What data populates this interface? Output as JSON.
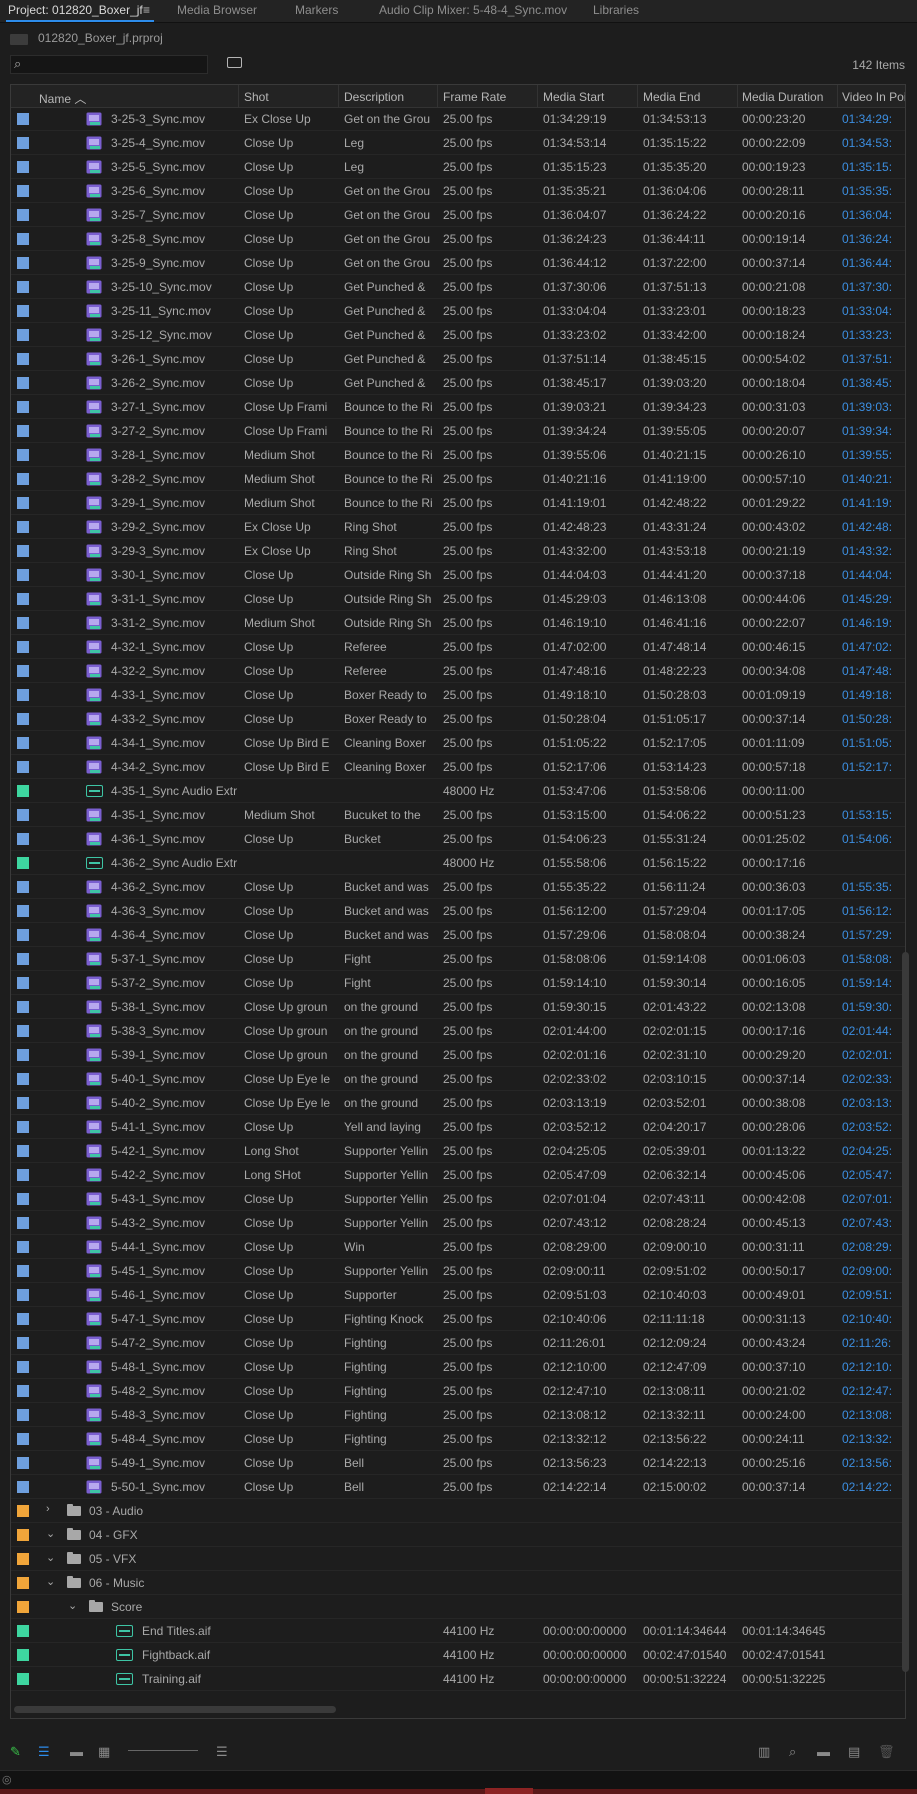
{
  "tabs": [
    {
      "label": "Project: 012820_Boxer_jf",
      "active": true
    },
    {
      "label": "Media Browser"
    },
    {
      "label": "Markers"
    },
    {
      "label": "Audio Clip Mixer: 5-48-4_Sync.mov"
    },
    {
      "label": "Libraries"
    }
  ],
  "tab_menu_icon": "≡",
  "project_path": "012820_Boxer_jf.prproj",
  "search": {
    "placeholder": "",
    "value": ""
  },
  "item_count": "142 Items",
  "columns": [
    "Name",
    "Shot",
    "Description",
    "Frame Rate",
    "Media Start",
    "Media End",
    "Media Duration",
    "Video In Poi"
  ],
  "colors": {
    "blue_label": "#6e9fde",
    "green_label": "#3ed6a0",
    "orange_label": "#f0a53a",
    "link_blue": "#3c8ee0",
    "tab_accent": "#2d8ceb"
  },
  "rows": [
    {
      "name": "3-25-3_Sync.mov",
      "shot": "Ex Close Up",
      "desc": "Get on the Grou",
      "rate": "25.00 fps",
      "start": "01:34:29:19",
      "end": "01:34:53:13",
      "dur": "00:00:23:20",
      "vin": "01:34:29:"
    },
    {
      "name": "3-25-4_Sync.mov",
      "shot": "Close Up",
      "desc": "Leg",
      "rate": "25.00 fps",
      "start": "01:34:53:14",
      "end": "01:35:15:22",
      "dur": "00:00:22:09",
      "vin": "01:34:53:"
    },
    {
      "name": "3-25-5_Sync.mov",
      "shot": "Close Up",
      "desc": "Leg",
      "rate": "25.00 fps",
      "start": "01:35:15:23",
      "end": "01:35:35:20",
      "dur": "00:00:19:23",
      "vin": "01:35:15:"
    },
    {
      "name": "3-25-6_Sync.mov",
      "shot": "Close Up",
      "desc": "Get on the Grou",
      "rate": "25.00 fps",
      "start": "01:35:35:21",
      "end": "01:36:04:06",
      "dur": "00:00:28:11",
      "vin": "01:35:35:"
    },
    {
      "name": "3-25-7_Sync.mov",
      "shot": "Close Up",
      "desc": "Get on the Grou",
      "rate": "25.00 fps",
      "start": "01:36:04:07",
      "end": "01:36:24:22",
      "dur": "00:00:20:16",
      "vin": "01:36:04:"
    },
    {
      "name": "3-25-8_Sync.mov",
      "shot": "Close Up",
      "desc": "Get on the Grou",
      "rate": "25.00 fps",
      "start": "01:36:24:23",
      "end": "01:36:44:11",
      "dur": "00:00:19:14",
      "vin": "01:36:24:"
    },
    {
      "name": "3-25-9_Sync.mov",
      "shot": "Close Up",
      "desc": "Get on the Grou",
      "rate": "25.00 fps",
      "start": "01:36:44:12",
      "end": "01:37:22:00",
      "dur": "00:00:37:14",
      "vin": "01:36:44:"
    },
    {
      "name": "3-25-10_Sync.mov",
      "shot": "Close Up",
      "desc": "Get Punched &",
      "rate": "25.00 fps",
      "start": "01:37:30:06",
      "end": "01:37:51:13",
      "dur": "00:00:21:08",
      "vin": "01:37:30:"
    },
    {
      "name": "3-25-11_Sync.mov",
      "shot": "Close Up",
      "desc": "Get Punched &",
      "rate": "25.00 fps",
      "start": "01:33:04:04",
      "end": "01:33:23:01",
      "dur": "00:00:18:23",
      "vin": "01:33:04:"
    },
    {
      "name": "3-25-12_Sync.mov",
      "shot": "Close Up",
      "desc": "Get Punched &",
      "rate": "25.00 fps",
      "start": "01:33:23:02",
      "end": "01:33:42:00",
      "dur": "00:00:18:24",
      "vin": "01:33:23:"
    },
    {
      "name": "3-26-1_Sync.mov",
      "shot": "Close Up",
      "desc": "Get Punched &",
      "rate": "25.00 fps",
      "start": "01:37:51:14",
      "end": "01:38:45:15",
      "dur": "00:00:54:02",
      "vin": "01:37:51:"
    },
    {
      "name": "3-26-2_Sync.mov",
      "shot": "Close Up",
      "desc": "Get Punched &",
      "rate": "25.00 fps",
      "start": "01:38:45:17",
      "end": "01:39:03:20",
      "dur": "00:00:18:04",
      "vin": "01:38:45:"
    },
    {
      "name": "3-27-1_Sync.mov",
      "shot": "Close Up Frami",
      "desc": "Bounce to the Ri",
      "rate": "25.00 fps",
      "start": "01:39:03:21",
      "end": "01:39:34:23",
      "dur": "00:00:31:03",
      "vin": "01:39:03:"
    },
    {
      "name": "3-27-2_Sync.mov",
      "shot": "Close Up Frami",
      "desc": "Bounce to the Ri",
      "rate": "25.00 fps",
      "start": "01:39:34:24",
      "end": "01:39:55:05",
      "dur": "00:00:20:07",
      "vin": "01:39:34:"
    },
    {
      "name": "3-28-1_Sync.mov",
      "shot": "Medium Shot",
      "desc": "Bounce to the Ri",
      "rate": "25.00 fps",
      "start": "01:39:55:06",
      "end": "01:40:21:15",
      "dur": "00:00:26:10",
      "vin": "01:39:55:"
    },
    {
      "name": "3-28-2_Sync.mov",
      "shot": "Medium Shot",
      "desc": "Bounce to the Ri",
      "rate": "25.00 fps",
      "start": "01:40:21:16",
      "end": "01:41:19:00",
      "dur": "00:00:57:10",
      "vin": "01:40:21:"
    },
    {
      "name": "3-29-1_Sync.mov",
      "shot": "Medium Shot",
      "desc": "Bounce to the Ri",
      "rate": "25.00 fps",
      "start": "01:41:19:01",
      "end": "01:42:48:22",
      "dur": "00:01:29:22",
      "vin": "01:41:19:"
    },
    {
      "name": "3-29-2_Sync.mov",
      "shot": "Ex Close Up",
      "desc": "Ring Shot",
      "rate": "25.00 fps",
      "start": "01:42:48:23",
      "end": "01:43:31:24",
      "dur": "00:00:43:02",
      "vin": "01:42:48:"
    },
    {
      "name": "3-29-3_Sync.mov",
      "shot": "Ex Close Up",
      "desc": "Ring Shot",
      "rate": "25.00 fps",
      "start": "01:43:32:00",
      "end": "01:43:53:18",
      "dur": "00:00:21:19",
      "vin": "01:43:32:"
    },
    {
      "name": "3-30-1_Sync.mov",
      "shot": "Close Up",
      "desc": "Outside Ring Sh",
      "rate": "25.00 fps",
      "start": "01:44:04:03",
      "end": "01:44:41:20",
      "dur": "00:00:37:18",
      "vin": "01:44:04:"
    },
    {
      "name": "3-31-1_Sync.mov",
      "shot": "Close Up",
      "desc": "Outside Ring Sh",
      "rate": "25.00 fps",
      "start": "01:45:29:03",
      "end": "01:46:13:08",
      "dur": "00:00:44:06",
      "vin": "01:45:29:"
    },
    {
      "name": "3-31-2_Sync.mov",
      "shot": "Medium Shot",
      "desc": "Outside Ring Sh",
      "rate": "25.00 fps",
      "start": "01:46:19:10",
      "end": "01:46:41:16",
      "dur": "00:00:22:07",
      "vin": "01:46:19:"
    },
    {
      "name": "4-32-1_Sync.mov",
      "shot": "Close Up",
      "desc": "Referee",
      "rate": "25.00 fps",
      "start": "01:47:02:00",
      "end": "01:47:48:14",
      "dur": "00:00:46:15",
      "vin": "01:47:02:"
    },
    {
      "name": "4-32-2_Sync.mov",
      "shot": "Close Up",
      "desc": "Referee",
      "rate": "25.00 fps",
      "start": "01:47:48:16",
      "end": "01:48:22:23",
      "dur": "00:00:34:08",
      "vin": "01:47:48:"
    },
    {
      "name": "4-33-1_Sync.mov",
      "shot": "Close Up",
      "desc": "Boxer Ready to",
      "rate": "25.00 fps",
      "start": "01:49:18:10",
      "end": "01:50:28:03",
      "dur": "00:01:09:19",
      "vin": "01:49:18:"
    },
    {
      "name": "4-33-2_Sync.mov",
      "shot": "Close Up",
      "desc": "Boxer Ready to",
      "rate": "25.00 fps",
      "start": "01:50:28:04",
      "end": "01:51:05:17",
      "dur": "00:00:37:14",
      "vin": "01:50:28:"
    },
    {
      "name": "4-34-1_Sync.mov",
      "shot": "Close Up Bird E",
      "desc": "Cleaning Boxer",
      "rate": "25.00 fps",
      "start": "01:51:05:22",
      "end": "01:52:17:05",
      "dur": "00:01:11:09",
      "vin": "01:51:05:"
    },
    {
      "name": "4-34-2_Sync.mov",
      "shot": "Close Up Bird E",
      "desc": "Cleaning Boxer",
      "rate": "25.00 fps",
      "start": "01:52:17:06",
      "end": "01:53:14:23",
      "dur": "00:00:57:18",
      "vin": "01:52:17:"
    },
    {
      "name": "4-35-1_Sync Audio Extr",
      "type": "audio",
      "shot": "",
      "desc": "",
      "rate": "48000 Hz",
      "start": "01:53:47:06",
      "end": "01:53:58:06",
      "dur": "00:00:11:00",
      "vin": ""
    },
    {
      "name": "4-35-1_Sync.mov",
      "shot": "Medium Shot",
      "desc": "Bucuket to the",
      "rate": "25.00 fps",
      "start": "01:53:15:00",
      "end": "01:54:06:22",
      "dur": "00:00:51:23",
      "vin": "01:53:15:"
    },
    {
      "name": "4-36-1_Sync.mov",
      "shot": "Close Up",
      "desc": "Bucket",
      "rate": "25.00 fps",
      "start": "01:54:06:23",
      "end": "01:55:31:24",
      "dur": "00:01:25:02",
      "vin": "01:54:06:"
    },
    {
      "name": "4-36-2_Sync Audio Extr",
      "type": "audio",
      "shot": "",
      "desc": "",
      "rate": "48000 Hz",
      "start": "01:55:58:06",
      "end": "01:56:15:22",
      "dur": "00:00:17:16",
      "vin": ""
    },
    {
      "name": "4-36-2_Sync.mov",
      "shot": "Close Up",
      "desc": "Bucket and was",
      "rate": "25.00 fps",
      "start": "01:55:35:22",
      "end": "01:56:11:24",
      "dur": "00:00:36:03",
      "vin": "01:55:35:"
    },
    {
      "name": "4-36-3_Sync.mov",
      "shot": "Close Up",
      "desc": "Bucket and was",
      "rate": "25.00 fps",
      "start": "01:56:12:00",
      "end": "01:57:29:04",
      "dur": "00:01:17:05",
      "vin": "01:56:12:"
    },
    {
      "name": "4-36-4_Sync.mov",
      "shot": "Close Up",
      "desc": "Bucket and was",
      "rate": "25.00 fps",
      "start": "01:57:29:06",
      "end": "01:58:08:04",
      "dur": "00:00:38:24",
      "vin": "01:57:29:"
    },
    {
      "name": "5-37-1_Sync.mov",
      "shot": "Close Up",
      "desc": "Fight",
      "rate": "25.00 fps",
      "start": "01:58:08:06",
      "end": "01:59:14:08",
      "dur": "00:01:06:03",
      "vin": "01:58:08:"
    },
    {
      "name": "5-37-2_Sync.mov",
      "shot": "Close Up",
      "desc": "Fight",
      "rate": "25.00 fps",
      "start": "01:59:14:10",
      "end": "01:59:30:14",
      "dur": "00:00:16:05",
      "vin": "01:59:14:"
    },
    {
      "name": "5-38-1_Sync.mov",
      "shot": "Close Up groun",
      "desc": "on the ground",
      "rate": "25.00 fps",
      "start": "01:59:30:15",
      "end": "02:01:43:22",
      "dur": "00:02:13:08",
      "vin": "01:59:30:"
    },
    {
      "name": "5-38-3_Sync.mov",
      "shot": "Close Up groun",
      "desc": "on the ground",
      "rate": "25.00 fps",
      "start": "02:01:44:00",
      "end": "02:02:01:15",
      "dur": "00:00:17:16",
      "vin": "02:01:44:"
    },
    {
      "name": "5-39-1_Sync.mov",
      "shot": "Close Up groun",
      "desc": "on the ground",
      "rate": "25.00 fps",
      "start": "02:02:01:16",
      "end": "02:02:31:10",
      "dur": "00:00:29:20",
      "vin": "02:02:01:"
    },
    {
      "name": "5-40-1_Sync.mov",
      "shot": "Close Up Eye le",
      "desc": "on the ground",
      "rate": "25.00 fps",
      "start": "02:02:33:02",
      "end": "02:03:10:15",
      "dur": "00:00:37:14",
      "vin": "02:02:33:"
    },
    {
      "name": "5-40-2_Sync.mov",
      "shot": "Close Up Eye le",
      "desc": "on the ground",
      "rate": "25.00 fps",
      "start": "02:03:13:19",
      "end": "02:03:52:01",
      "dur": "00:00:38:08",
      "vin": "02:03:13:"
    },
    {
      "name": "5-41-1_Sync.mov",
      "shot": "Close Up",
      "desc": "Yell and laying",
      "rate": "25.00 fps",
      "start": "02:03:52:12",
      "end": "02:04:20:17",
      "dur": "00:00:28:06",
      "vin": "02:03:52:"
    },
    {
      "name": "5-42-1_Sync.mov",
      "shot": "Long Shot",
      "desc": "Supporter Yellin",
      "rate": "25.00 fps",
      "start": "02:04:25:05",
      "end": "02:05:39:01",
      "dur": "00:01:13:22",
      "vin": "02:04:25:"
    },
    {
      "name": "5-42-2_Sync.mov",
      "shot": "Long SHot",
      "desc": "Supporter Yellin",
      "rate": "25.00 fps",
      "start": "02:05:47:09",
      "end": "02:06:32:14",
      "dur": "00:00:45:06",
      "vin": "02:05:47:"
    },
    {
      "name": "5-43-1_Sync.mov",
      "shot": "Close Up",
      "desc": "Supporter Yellin",
      "rate": "25.00 fps",
      "start": "02:07:01:04",
      "end": "02:07:43:11",
      "dur": "00:00:42:08",
      "vin": "02:07:01:"
    },
    {
      "name": "5-43-2_Sync.mov",
      "shot": "Close Up",
      "desc": "Supporter Yellin",
      "rate": "25.00 fps",
      "start": "02:07:43:12",
      "end": "02:08:28:24",
      "dur": "00:00:45:13",
      "vin": "02:07:43:"
    },
    {
      "name": "5-44-1_Sync.mov",
      "shot": "Close Up",
      "desc": "Win",
      "rate": "25.00 fps",
      "start": "02:08:29:00",
      "end": "02:09:00:10",
      "dur": "00:00:31:11",
      "vin": "02:08:29:"
    },
    {
      "name": "5-45-1_Sync.mov",
      "shot": "Close Up",
      "desc": "Supporter Yellin",
      "rate": "25.00 fps",
      "start": "02:09:00:11",
      "end": "02:09:51:02",
      "dur": "00:00:50:17",
      "vin": "02:09:00:"
    },
    {
      "name": "5-46-1_Sync.mov",
      "shot": "Close  Up",
      "desc": "Supporter",
      "rate": "25.00 fps",
      "start": "02:09:51:03",
      "end": "02:10:40:03",
      "dur": "00:00:49:01",
      "vin": "02:09:51:"
    },
    {
      "name": "5-47-1_Sync.mov",
      "shot": "Close Up",
      "desc": "Fighting Knock",
      "rate": "25.00 fps",
      "start": "02:10:40:06",
      "end": "02:11:11:18",
      "dur": "00:00:31:13",
      "vin": "02:10:40:"
    },
    {
      "name": "5-47-2_Sync.mov",
      "shot": "Close Up",
      "desc": "Fighting",
      "rate": "25.00 fps",
      "start": "02:11:26:01",
      "end": "02:12:09:24",
      "dur": "00:00:43:24",
      "vin": "02:11:26:"
    },
    {
      "name": "5-48-1_Sync.mov",
      "shot": "Close Up",
      "desc": "Fighting",
      "rate": "25.00 fps",
      "start": "02:12:10:00",
      "end": "02:12:47:09",
      "dur": "00:00:37:10",
      "vin": "02:12:10:"
    },
    {
      "name": "5-48-2_Sync.mov",
      "shot": "Close Up",
      "desc": "Fighting",
      "rate": "25.00 fps",
      "start": "02:12:47:10",
      "end": "02:13:08:11",
      "dur": "00:00:21:02",
      "vin": "02:12:47:"
    },
    {
      "name": "5-48-3_Sync.mov",
      "shot": "Close Up",
      "desc": "Fighting",
      "rate": "25.00 fps",
      "start": "02:13:08:12",
      "end": "02:13:32:11",
      "dur": "00:00:24:00",
      "vin": "02:13:08:"
    },
    {
      "name": "5-48-4_Sync.mov",
      "shot": "Close Up",
      "desc": "Fighting",
      "rate": "25.00 fps",
      "start": "02:13:32:12",
      "end": "02:13:56:22",
      "dur": "00:00:24:11",
      "vin": "02:13:32:"
    },
    {
      "name": "5-49-1_Sync.mov",
      "shot": "Close Up",
      "desc": "Bell",
      "rate": "25.00 fps",
      "start": "02:13:56:23",
      "end": "02:14:22:13",
      "dur": "00:00:25:16",
      "vin": "02:13:56:"
    },
    {
      "name": "5-50-1_Sync.mov",
      "shot": "Close Up",
      "desc": "Bell",
      "rate": "25.00 fps",
      "start": "02:14:22:14",
      "end": "02:15:00:02",
      "dur": "00:00:37:14",
      "vin": "02:14:22:"
    },
    {
      "name": "03 - Audio",
      "type": "bin",
      "expanded": false,
      "depth": 0
    },
    {
      "name": "04 - GFX",
      "type": "bin",
      "expanded": true,
      "depth": 0
    },
    {
      "name": "05 - VFX",
      "type": "bin",
      "expanded": true,
      "depth": 0
    },
    {
      "name": "06 - Music",
      "type": "bin",
      "expanded": true,
      "depth": 0
    },
    {
      "name": "Score",
      "type": "bin",
      "expanded": true,
      "depth": 1
    },
    {
      "name": "End Titles.aif",
      "type": "audiofile",
      "shot": "",
      "desc": "",
      "rate": "44100 Hz",
      "start": "00:00:00:00000",
      "end": "00:01:14:34644",
      "dur": "00:01:14:34645",
      "vin": ""
    },
    {
      "name": "Fightback.aif",
      "type": "audiofile",
      "shot": "",
      "desc": "",
      "rate": "44100 Hz",
      "start": "00:00:00:00000",
      "end": "00:02:47:01540",
      "dur": "00:02:47:01541",
      "vin": ""
    },
    {
      "name": "Training.aif",
      "type": "audiofile",
      "shot": "",
      "desc": "",
      "rate": "44100 Hz",
      "start": "00:00:00:00000",
      "end": "00:00:51:32224",
      "dur": "00:00:51:32225",
      "vin": ""
    }
  ]
}
